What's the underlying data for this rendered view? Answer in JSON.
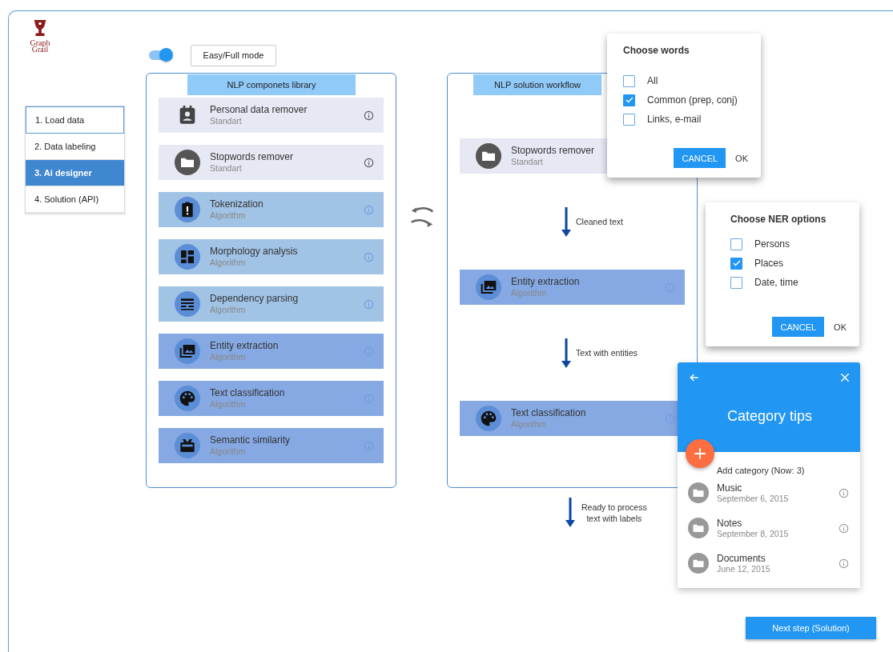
{
  "logo": {
    "lines": [
      "Graph",
      "Grail"
    ]
  },
  "steps": [
    {
      "label": "1. Load data",
      "selected": false
    },
    {
      "label": "2. Data labeling",
      "selected": false
    },
    {
      "label": "3. Ai designer",
      "selected": true
    },
    {
      "label": "4. Solution (API)",
      "selected": false
    }
  ],
  "mode_toggle": {
    "on": true
  },
  "mode_button": "Easy/Full mode",
  "library": {
    "title": "NLP componets library",
    "items": [
      {
        "kind": "contact",
        "name": "Personal data remover",
        "type": "Standart",
        "color": "#e6e8f4"
      },
      {
        "kind": "folder",
        "name": "Stopwords remover",
        "type": "Standart",
        "color": "#e6e8f4"
      },
      {
        "kind": "clipboard",
        "name": "Tokenization",
        "type": "Algorithm",
        "color": "#a1c3e6"
      },
      {
        "kind": "grid",
        "name": "Morphology analysis",
        "type": "Algorithm",
        "color": "#a1c3e6"
      },
      {
        "kind": "lines",
        "name": "Dependency parsing",
        "type": "Algorithm",
        "color": "#a1c3e6"
      },
      {
        "kind": "images",
        "name": "Entity extraction",
        "type": "Algorithm",
        "color": "#86a9e3"
      },
      {
        "kind": "palette",
        "name": "Text classification",
        "type": "Algorithm",
        "color": "#86a9e3"
      },
      {
        "kind": "gift",
        "name": "Semantic similarity",
        "type": "Algorithm",
        "color": "#86a9e3"
      }
    ]
  },
  "workflow": {
    "title": "NLP solution workflow",
    "steps": [
      {
        "kind": "folder",
        "name": "Stopwords remover",
        "type": "Standart",
        "color": "#e6e8f4"
      },
      {
        "kind": "connector",
        "label": "Cleaned text"
      },
      {
        "kind": "images",
        "name": "Entity extraction",
        "type": "Algorithm",
        "color": "#86a9e3",
        "info": true
      },
      {
        "kind": "connector",
        "label": "Text with entities"
      },
      {
        "kind": "palette",
        "name": "Text classification",
        "type": "Algorithm",
        "color": "#86a9e3",
        "info": true
      }
    ],
    "output": [
      "Ready to process",
      "text with labels"
    ]
  },
  "words_dialog": {
    "title": "Choose words",
    "options": [
      {
        "label": "All",
        "checked": false
      },
      {
        "label": "Common (prep, conj)",
        "checked": true
      },
      {
        "label": "Links, e-mail",
        "checked": false
      }
    ],
    "cancel": "CANCEL",
    "ok": "OK"
  },
  "ner_dialog": {
    "title": "Choose NER options",
    "options": [
      {
        "label": "Persons",
        "checked": false
      },
      {
        "label": "Places",
        "checked": true
      },
      {
        "label": "Date, time",
        "checked": false
      }
    ],
    "cancel": "CANCEL",
    "ok": "OK"
  },
  "category_panel": {
    "title": "Category tips",
    "add_label": "Add category (Now: 3)",
    "items": [
      {
        "name": "Music",
        "date": "September 6, 2015"
      },
      {
        "name": "Notes",
        "date": "September 8, 2015"
      },
      {
        "name": "Documents",
        "date": "June 12, 2015"
      }
    ]
  },
  "next_button": "Next step (Solution)"
}
